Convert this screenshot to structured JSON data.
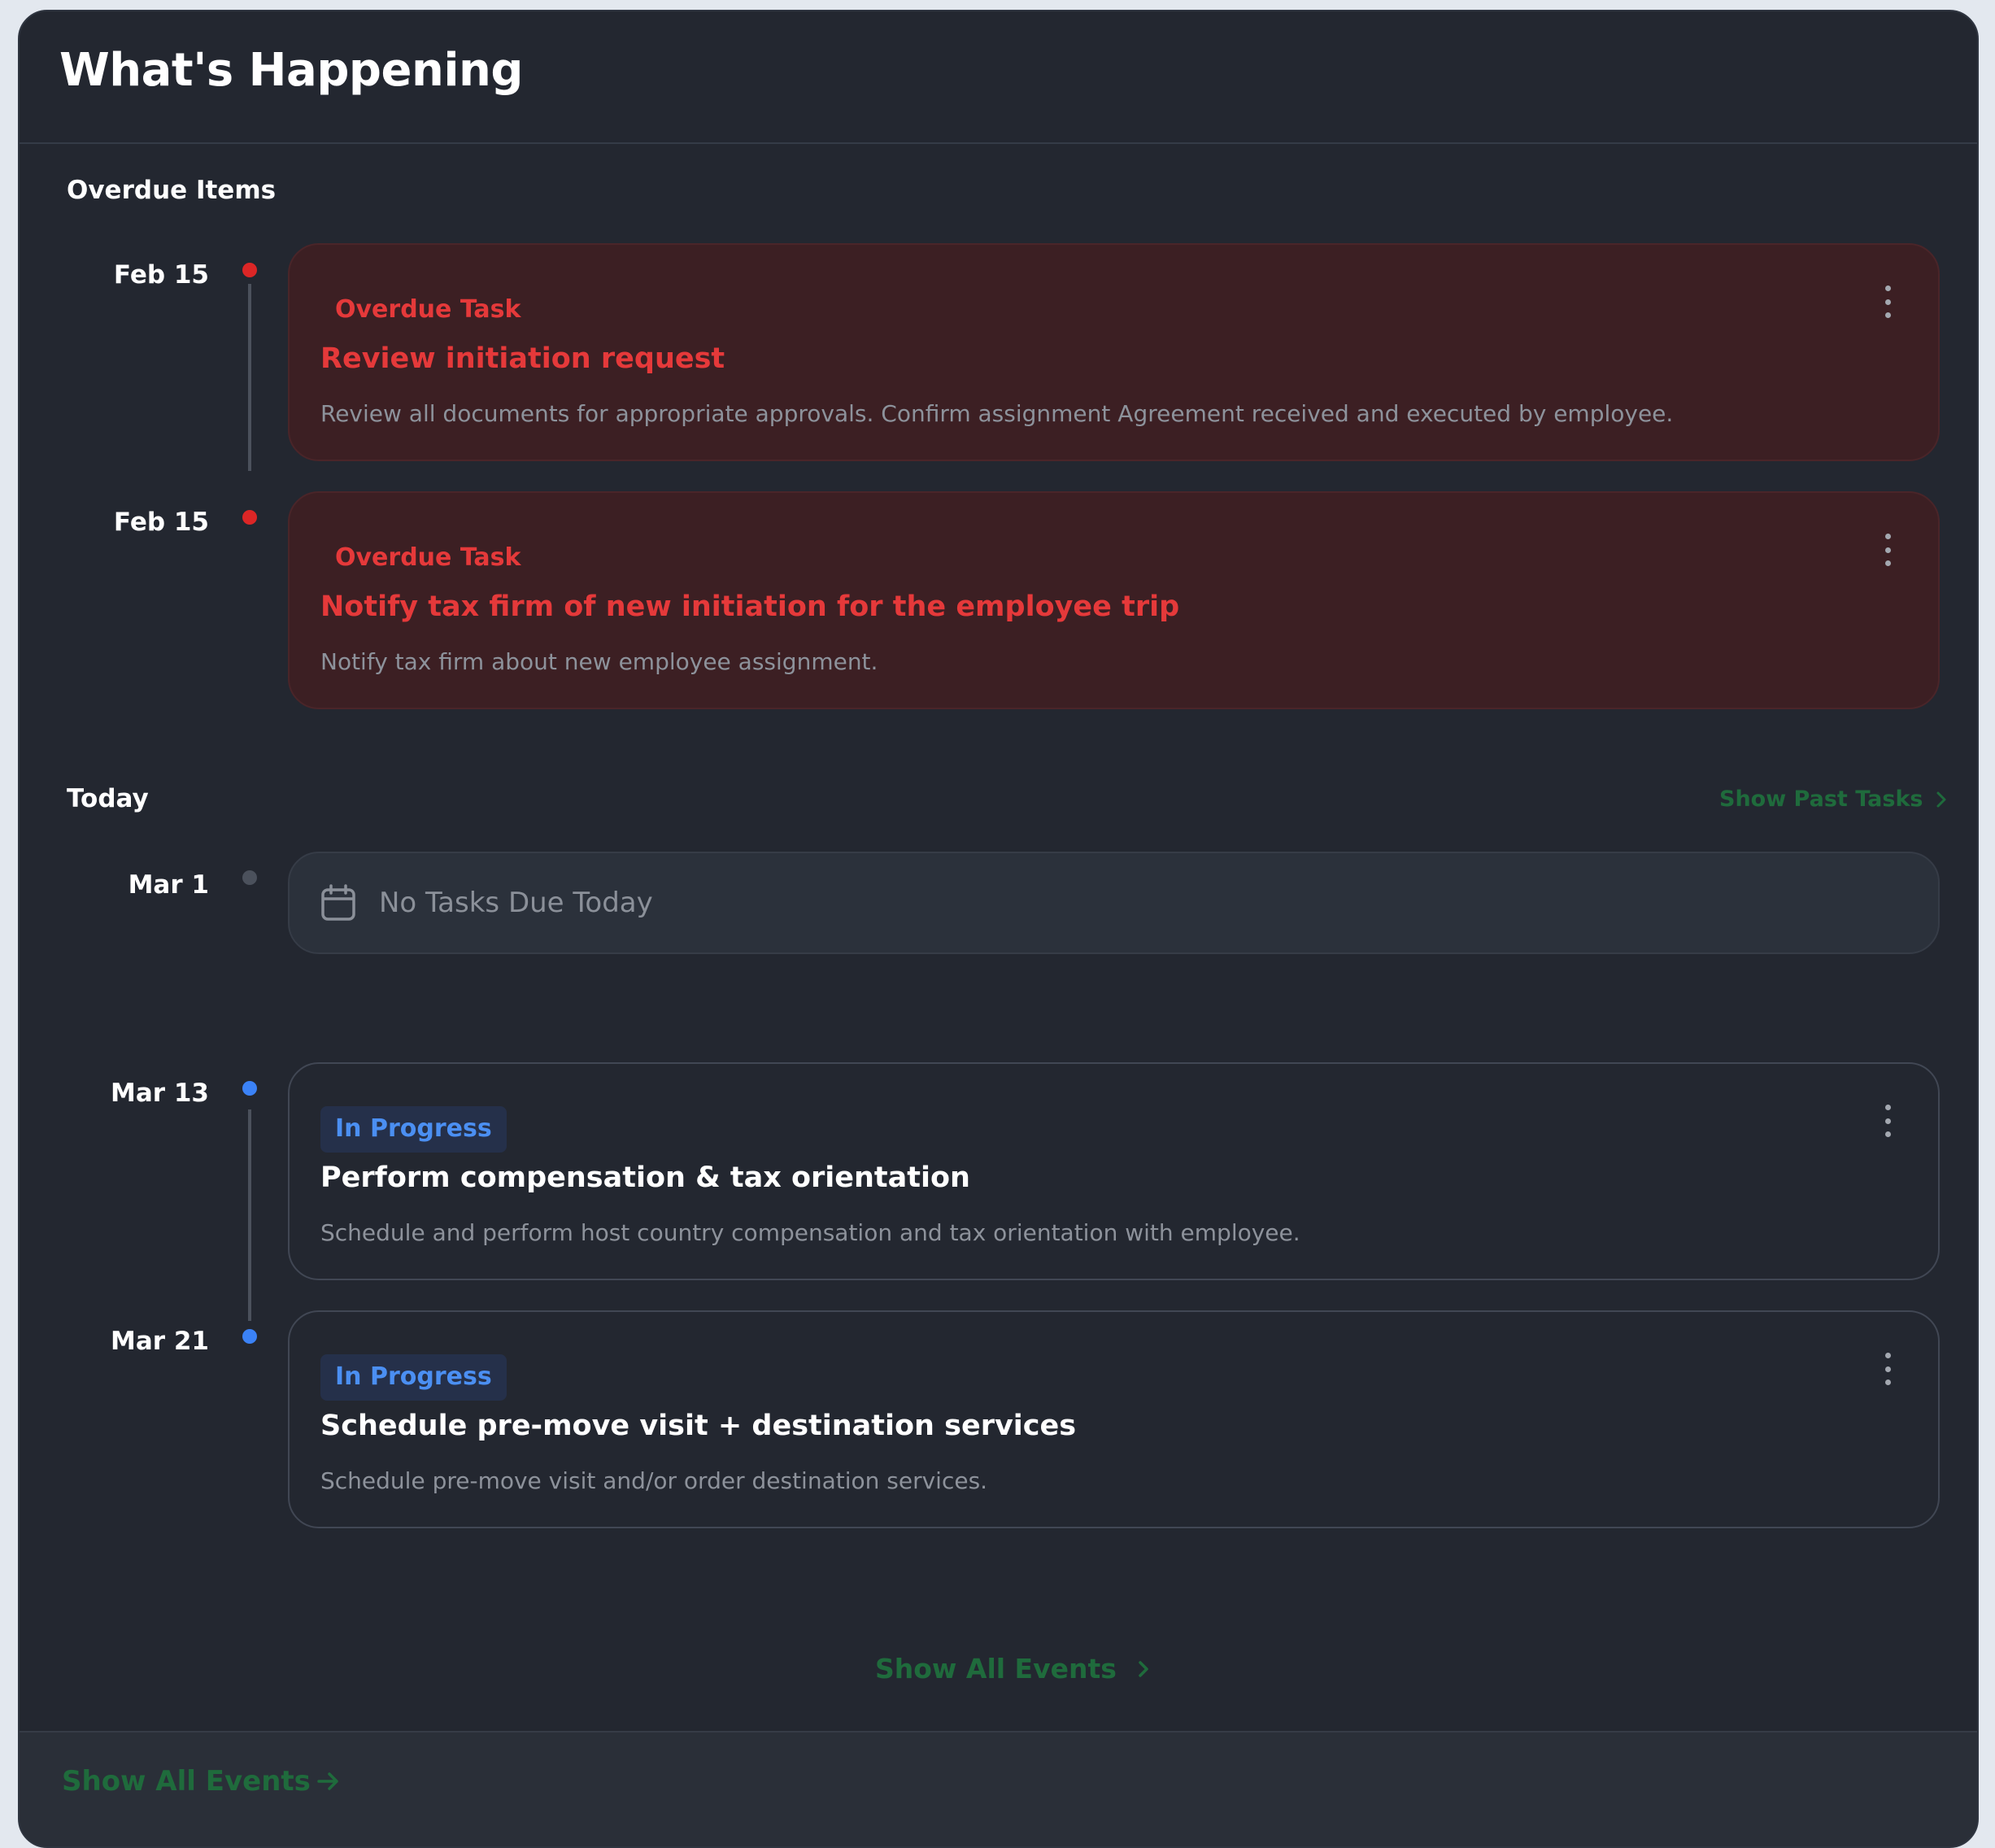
{
  "header": {
    "title": "What's Happening"
  },
  "sections": {
    "overdue": {
      "label": "Overdue Items"
    },
    "today": {
      "label": "Today",
      "show_past_label": "Show Past Tasks"
    }
  },
  "overdue_items": [
    {
      "date": "Feb 15",
      "badge": "Overdue Task",
      "title": "Review initiation request",
      "description": "Review all documents for appropriate approvals. Confirm assignment Agreement received and executed by employee."
    },
    {
      "date": "Feb 15",
      "badge": "Overdue Task",
      "title": "Notify tax firm of new initiation for the employee trip",
      "description": "Notify tax firm about new employee assignment."
    }
  ],
  "today": {
    "date": "Mar 1",
    "empty_text": "No Tasks Due Today"
  },
  "upcoming_items": [
    {
      "date": "Mar 13",
      "badge": "In Progress",
      "title": "Perform compensation & tax orientation",
      "description": "Schedule and perform host country compensation and tax orientation with employee."
    },
    {
      "date": "Mar 21",
      "badge": "In Progress",
      "title": "Schedule pre-move visit + destination services",
      "description": "Schedule pre-move visit and/or order destination services."
    }
  ],
  "links": {
    "show_all_events": "Show All Events",
    "footer_show_all_events": "Show All Events"
  },
  "colors": {
    "overdue_red": "#dc2626",
    "in_progress_blue": "#3b82f6",
    "link_green": "#1f6b3c",
    "panel_bg": "#232730"
  },
  "icons": {
    "kebab": "kebab-menu-icon",
    "calendar": "calendar-icon",
    "chevron": "chevron-right-icon",
    "arrow": "arrow-right-icon"
  }
}
